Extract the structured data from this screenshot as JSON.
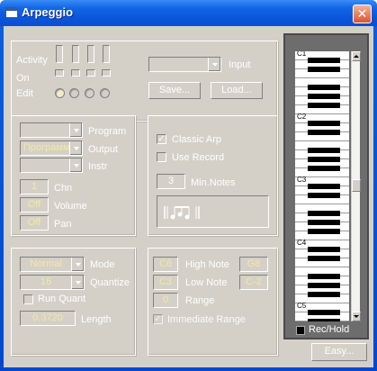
{
  "window": {
    "title": "Arpeggio",
    "close_label": "✕"
  },
  "top": {
    "activity_label": "Activity",
    "on_label": "On",
    "edit_label": "Edit",
    "input_label": "Input",
    "input_value": "",
    "save_label": "Save...",
    "load_label": "Load..."
  },
  "output_panel": {
    "program_label": "Program",
    "program_value": "",
    "output_label": "Output",
    "output_value": "Программ",
    "instr_label": "Instr",
    "instr_value": "",
    "chn_label": "Chn",
    "chn_value": "1",
    "volume_label": "Volume",
    "volume_value": "Off",
    "pan_label": "Pan",
    "pan_value": "Off"
  },
  "arp_panel": {
    "classic_label": "Classic Arp",
    "classic_checked": true,
    "use_record_label": "Use Record",
    "use_record_checked": false,
    "min_notes_label": "Min.Notes",
    "min_notes_value": "3"
  },
  "mode_panel": {
    "mode_label": "Mode",
    "mode_value": "Normal",
    "quantize_label": "Quantize",
    "quantize_value": "16",
    "run_quant_label": "Run Quant",
    "length_label": "Length",
    "length_value": "0.3720"
  },
  "range_panel": {
    "high_note_label": "High Note",
    "high_note_from": "C6",
    "high_note_to": "G8",
    "low_note_label": "Low Note",
    "low_note_from": "C3",
    "low_note_to": "C-2",
    "range_label": "Range",
    "range_value": "0",
    "immediate_label": "Immediate Range"
  },
  "keyboard": {
    "octave_labels": [
      "C1",
      "C2",
      "C3",
      "C4",
      "C5"
    ],
    "rec_hold_label": "Rec/Hold"
  },
  "footer": {
    "easy_label": "Easy..."
  }
}
